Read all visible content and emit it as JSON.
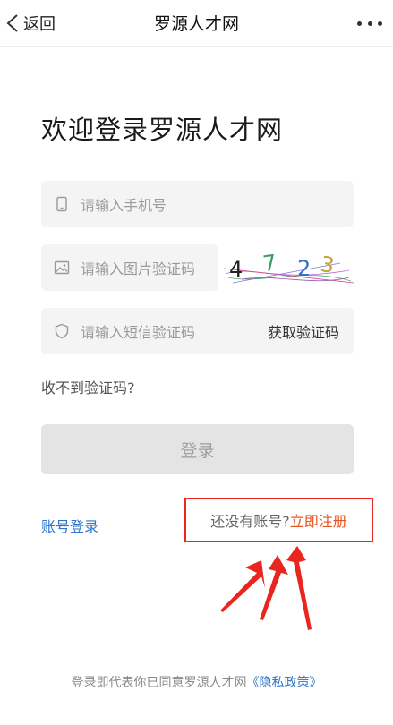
{
  "nav": {
    "back_label": "返回",
    "title": "罗源人才网"
  },
  "welcome_text": "欢迎登录罗源人才网",
  "form": {
    "phone_placeholder": "请输入手机号",
    "image_code_placeholder": "请输入图片验证码",
    "sms_code_placeholder": "请输入短信验证码",
    "get_code_label": "获取验证码",
    "captcha_chars": [
      "4",
      "7",
      "2",
      "3"
    ],
    "no_code_link": "收不到验证码?",
    "login_button": "登录"
  },
  "account_login_link": "账号登录",
  "register": {
    "question": "还没有账号?",
    "link": "立即注册"
  },
  "footer": {
    "text": "登录即代表你已同意罗源人才网",
    "policy_link": "《隐私政策》"
  },
  "colors": {
    "link_blue": "#2f76c9",
    "register_orange": "#e8541f",
    "highlight_red": "#e8261f"
  }
}
